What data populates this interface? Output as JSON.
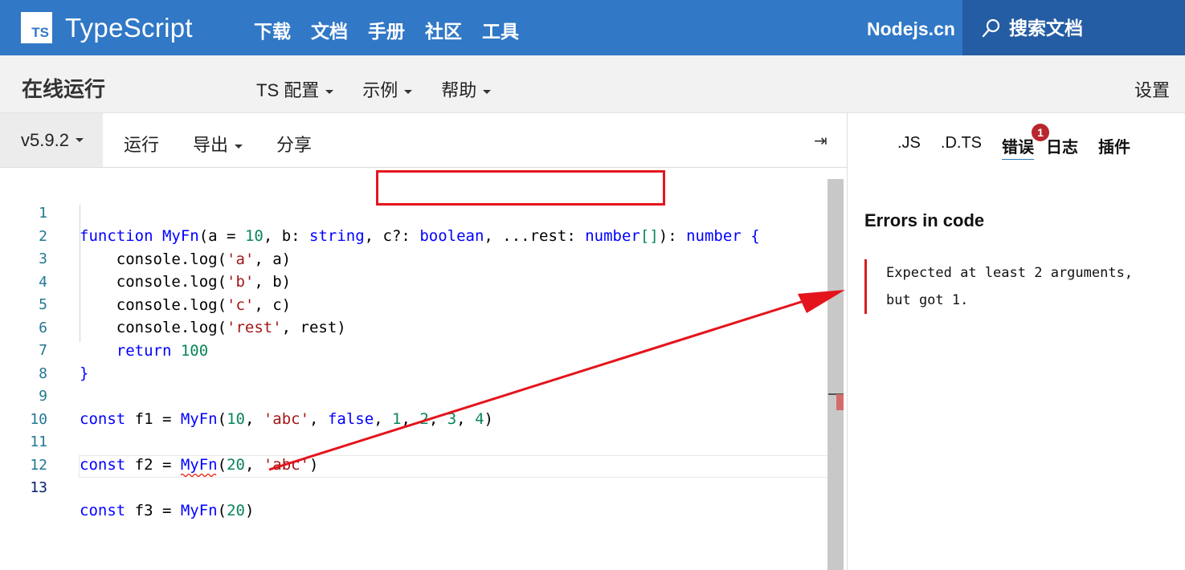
{
  "topnav": {
    "logo_text": "TS",
    "brand": "TypeScript",
    "links": [
      "下载",
      "文档",
      "手册",
      "社区",
      "工具"
    ],
    "nodejs": "Nodejs.cn",
    "search_label": "搜索文档"
  },
  "subbar": {
    "title": "在线运行",
    "menus": [
      "TS 配置",
      "示例",
      "帮助"
    ],
    "settings": "设置"
  },
  "toolbar": {
    "version": "v5.9.2",
    "run": "运行",
    "export": "导出",
    "share": "分享",
    "collapse_icon": "⇥"
  },
  "editor": {
    "line_numbers": [
      "1",
      "2",
      "3",
      "4",
      "5",
      "6",
      "7",
      "8",
      "9",
      "10",
      "11",
      "12",
      "13"
    ]
  },
  "right_panel": {
    "tabs": [
      ".JS",
      ".D.TS",
      "错误",
      "日志",
      "插件"
    ],
    "active_tab": "错误",
    "badge": "1",
    "errors_title": "Errors in code",
    "error_line1": "Expected at least 2 arguments,",
    "error_line2": "but got 1."
  },
  "colors": {
    "brand": "#3178c6",
    "search_bg": "#245da3",
    "error": "#d51e1e",
    "annotation": "#e4141c"
  }
}
